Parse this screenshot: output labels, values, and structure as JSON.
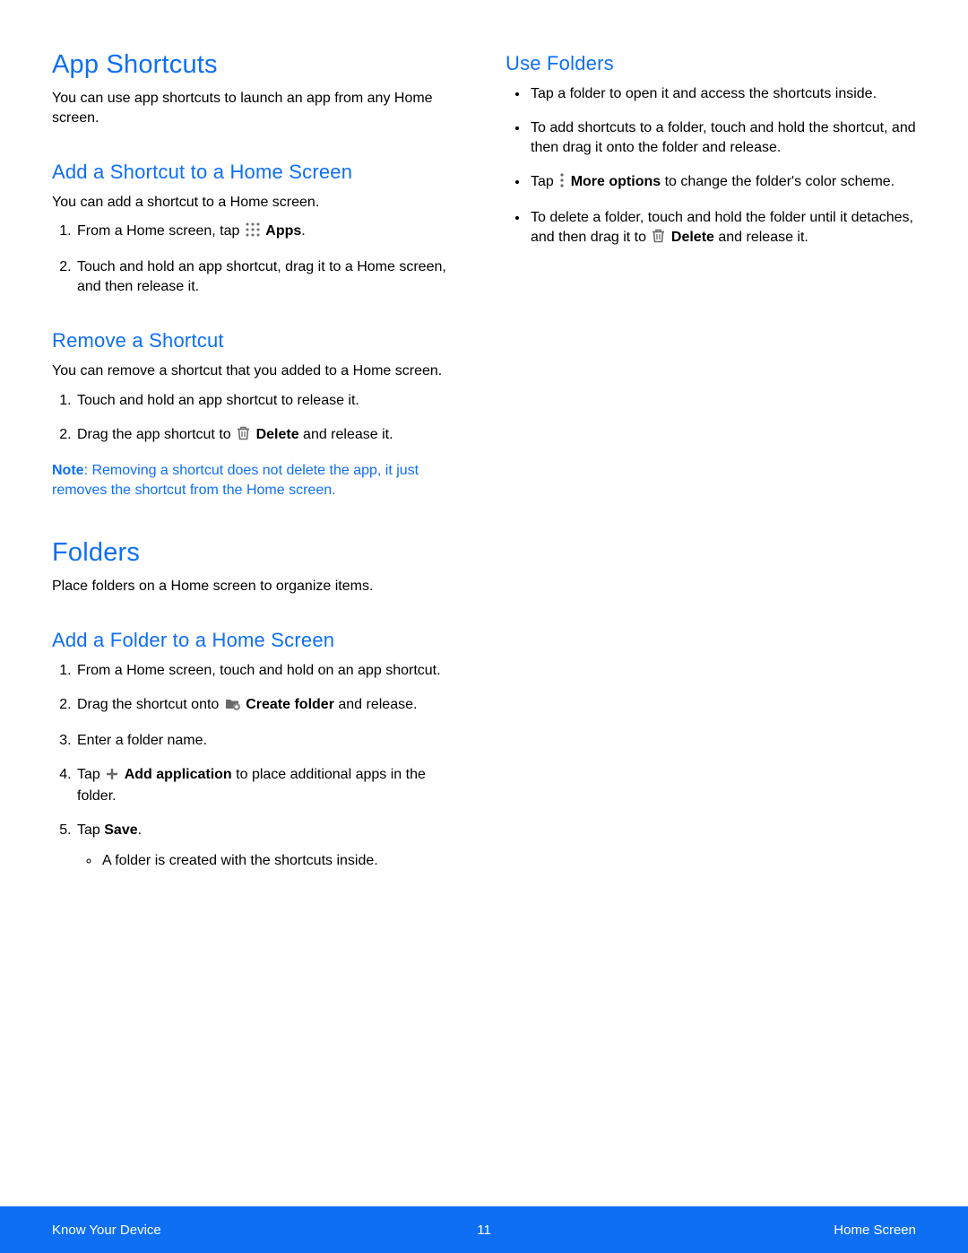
{
  "left": {
    "h1_app_shortcuts": "App Shortcuts",
    "p_app_shortcuts_intro": "You can use app shortcuts to launch an app from any Home screen.",
    "h2_add_shortcut": "Add a Shortcut to a Home Screen",
    "p_add_shortcut_intro": "You can add a shortcut to a Home screen.",
    "add_shortcut_step1_pre": "From a Home screen, tap ",
    "add_shortcut_step1_bold": "Apps",
    "add_shortcut_step1_post": ".",
    "add_shortcut_step2": "Touch and hold an app shortcut, drag it to a Home screen, and then release it.",
    "h2_remove_shortcut": "Remove a Shortcut",
    "p_remove_shortcut_intro": "You can remove a shortcut that you added to a Home screen.",
    "remove_step1": "Touch and hold an app shortcut to release it.",
    "remove_step2_pre": "Drag the app shortcut to ",
    "remove_step2_bold": "Delete",
    "remove_step2_post": " and release it.",
    "note_label": "Note",
    "note_text": ": Removing a shortcut does not delete the app, it just removes the shortcut from the Home screen.",
    "h1_folders": "Folders",
    "p_folders_intro": "Place folders on a Home screen to organize items.",
    "h2_add_folder": "Add a Folder to a Home Screen",
    "add_folder_step1": "From a Home screen, touch and hold on an app shortcut.",
    "add_folder_step2_pre": "Drag the shortcut onto ",
    "add_folder_step2_bold": "Create folder",
    "add_folder_step2_post": " and release.",
    "add_folder_step3": "Enter a folder name.",
    "add_folder_step4_pre": "Tap ",
    "add_folder_step4_bold": "Add application",
    "add_folder_step4_post": " to place additional apps in the folder.",
    "add_folder_step5_pre": "Tap ",
    "add_folder_step5_bold": "Save",
    "add_folder_step5_post": ".",
    "add_folder_sub": "A folder is created with the shortcuts inside."
  },
  "right": {
    "h2_use_folders": "Use Folders",
    "use_b1": "Tap a folder to open it and access the shortcuts inside.",
    "use_b2": "To add shortcuts to a folder, touch and hold the shortcut, and then drag it onto the folder and release.",
    "use_b3_pre": "Tap ",
    "use_b3_bold": "More options",
    "use_b3_post": " to change the folder's color scheme.",
    "use_b4_pre": "To delete a folder, touch and hold the folder until it detaches, and then drag it to ",
    "use_b4_bold": "Delete",
    "use_b4_post": " and release it."
  },
  "footer": {
    "left": "Know Your Device",
    "center": "11",
    "right": "Home Screen"
  },
  "icons": {
    "apps": "apps-icon",
    "delete": "delete-icon",
    "create_folder": "create-folder-icon",
    "plus": "plus-icon",
    "more": "more-options-icon"
  }
}
